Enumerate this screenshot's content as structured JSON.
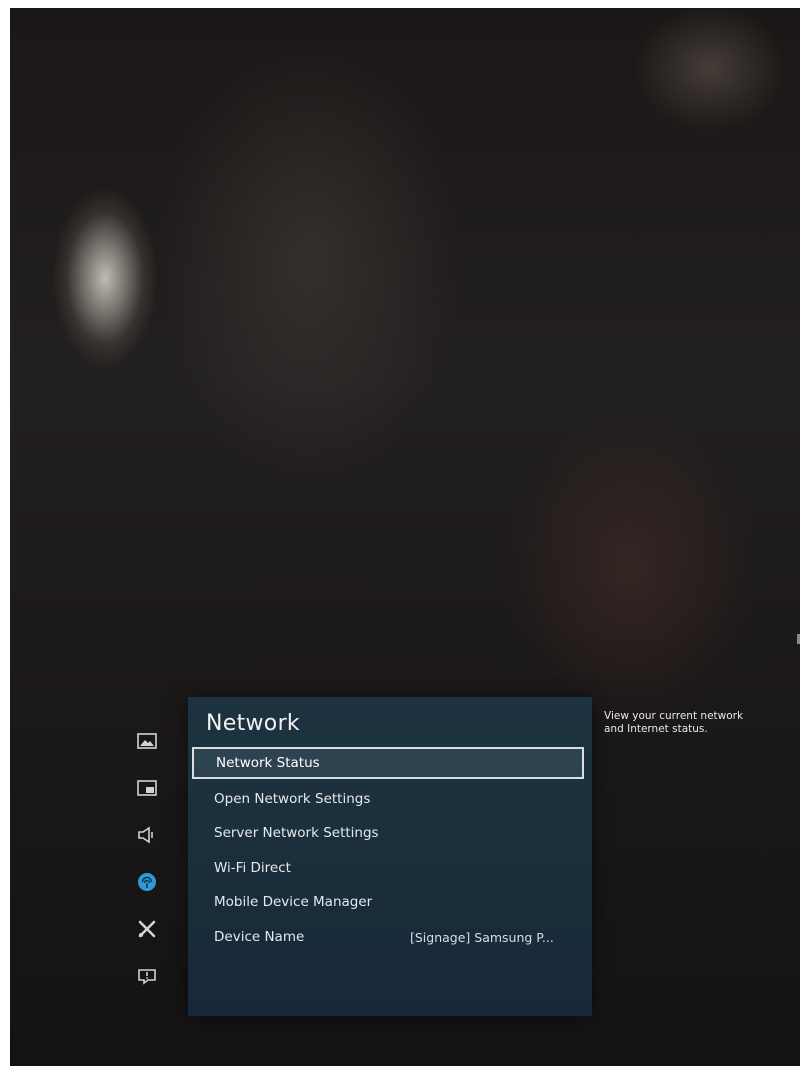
{
  "menu": {
    "title": "Network",
    "items": [
      {
        "label": "Network Status",
        "selected": true
      },
      {
        "label": "Open Network Settings"
      },
      {
        "label": "Server Network Settings"
      },
      {
        "label": "Wi-Fi Direct"
      },
      {
        "label": "Mobile Device Manager"
      },
      {
        "label": "Device Name",
        "value": "[Signage] Samsung P..."
      }
    ]
  },
  "help": {
    "description": "View your current network and Internet status."
  },
  "sidebar": {
    "icons": [
      {
        "name": "picture-icon"
      },
      {
        "name": "onscreen-display-icon"
      },
      {
        "name": "sound-icon"
      },
      {
        "name": "network-icon",
        "active": true,
        "color": "#2f9bd6"
      },
      {
        "name": "system-icon"
      },
      {
        "name": "support-icon"
      }
    ]
  },
  "colors": {
    "panel_background": "#1b2f3c",
    "selection_border": "#d9dde0",
    "active_icon": "#2f9bd6"
  }
}
